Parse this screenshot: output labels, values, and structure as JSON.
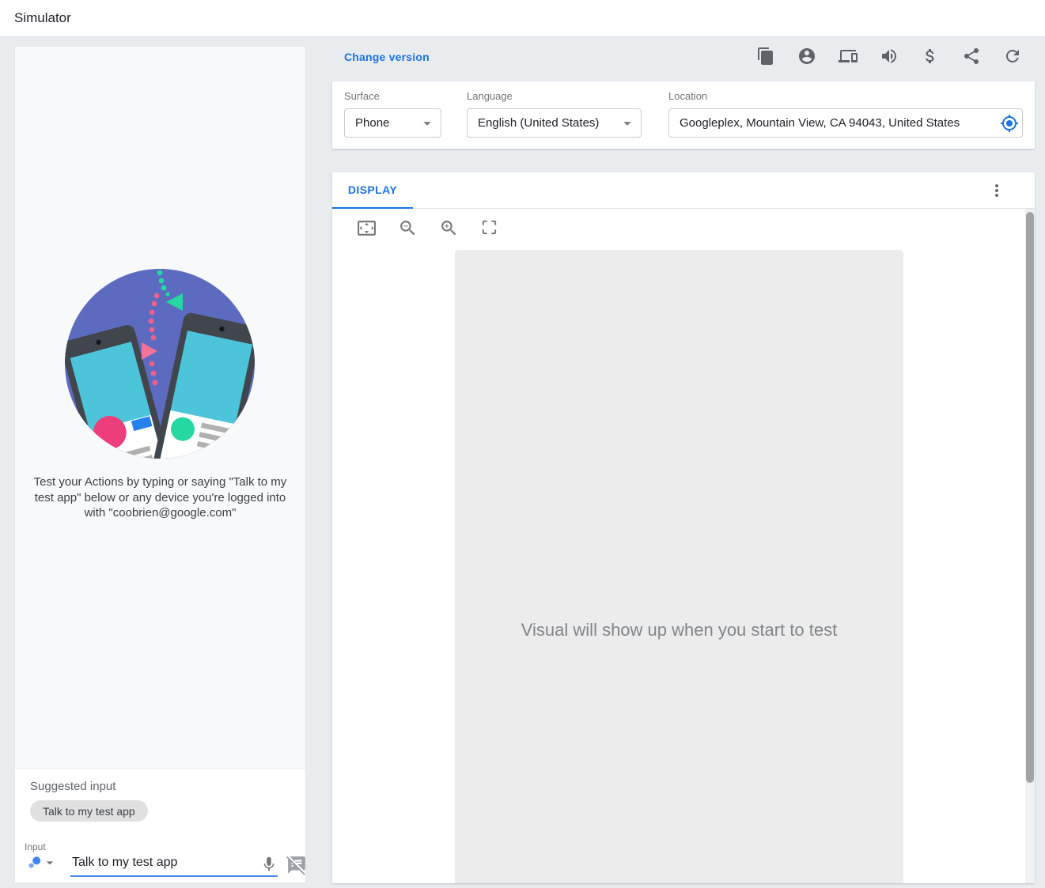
{
  "window": {
    "title": "Simulator"
  },
  "simulator_header": {
    "change_version": "Change version",
    "action_icons": [
      "copy-output-icon",
      "account-icon",
      "devices-icon",
      "volume-icon",
      "billing-icon",
      "share-icon",
      "refresh-icon"
    ]
  },
  "settings_bar": {
    "surface": {
      "label": "Surface",
      "value": "Phone"
    },
    "language": {
      "label": "Language",
      "value": "English (United States)"
    },
    "location": {
      "label": "Location",
      "value": "Googleplex, Mountain View, CA 94043, United States",
      "icon": "my-location-icon"
    }
  },
  "display_panel": {
    "tab": "DISPLAY",
    "menu_icon": "more-vert-icon",
    "toolbar_icons": [
      "fit-to-screen-icon",
      "zoom-out-icon",
      "zoom-in-icon",
      "fullscreen-icon"
    ],
    "placeholder": "Visual will show up when you start to test"
  },
  "left_panel": {
    "instructions": "Test your Actions by typing or saying \"Talk to my test app\" below or any device you're logged into with \"coobrien@google.com\"",
    "suggested_input_label": "Suggested input",
    "suggestion_chip": "Talk to my test app",
    "input": {
      "label": "Input",
      "value": "Talk to my test app",
      "icons": [
        "assistant-icon",
        "dropdown-caret-icon",
        "mic-icon",
        "speaker-notes-off-icon"
      ]
    }
  },
  "colors": {
    "accent_blue": "#1a73e8",
    "underline_blue": "#4285f4",
    "illustration_purple": "#5c6bc0",
    "illustration_teal": "#4cc4d9",
    "illustration_pink": "#ee3d7d",
    "illustration_green": "#25d8a2",
    "visual_area_gray": "#ececec"
  }
}
